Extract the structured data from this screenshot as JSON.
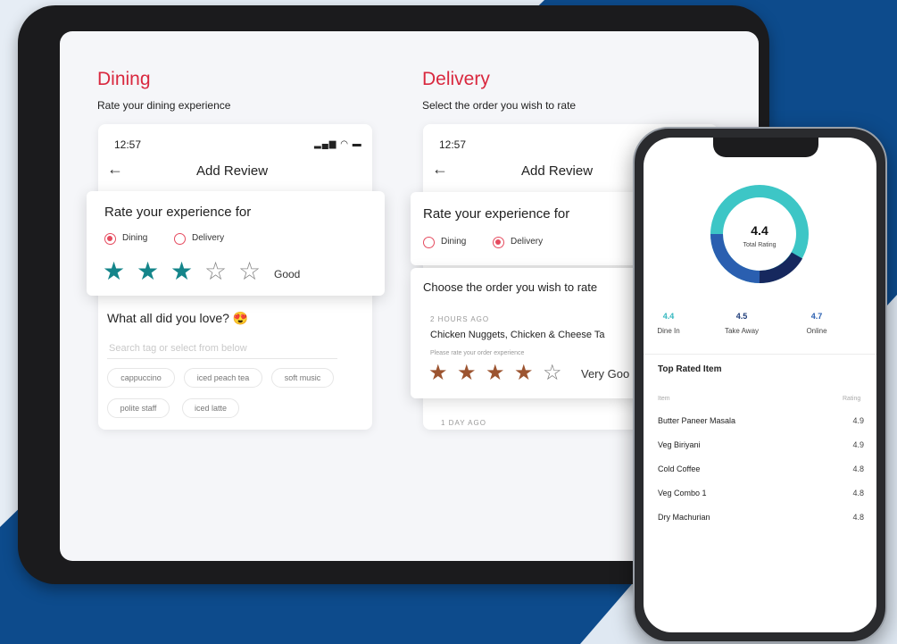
{
  "dining": {
    "title": "Dining",
    "subtitle": "Rate your dining experience",
    "time": "12:57",
    "header": "Add Review",
    "rate_title": "Rate your experience for",
    "radio_dining": "Dining",
    "radio_delivery": "Delivery",
    "selected": "Dining",
    "stars_filled": 3,
    "stars_total": 5,
    "rating_label": "Good",
    "love_question": "What all did you love? 😍",
    "search_placeholder": "Search tag or select from below",
    "tags": [
      "cappuccino",
      "iced peach tea",
      "soft music",
      "polite staff",
      "iced latte"
    ]
  },
  "delivery": {
    "title": "Delivery",
    "subtitle": "Select the order you wish to rate",
    "time": "12:57",
    "header": "Add Review",
    "rate_title": "Rate your experience for",
    "radio_dining": "Dining",
    "radio_delivery": "Delivery",
    "selected": "Delivery",
    "choose_title": "Choose the order you wish to rate",
    "order1": {
      "ago": "2 HOURS AGO",
      "name": "Chicken Nuggets, Chicken & Cheese Ta",
      "prompt": "Please rate your order experience",
      "stars_filled": 4,
      "rating_label": "Very Goo"
    },
    "order2_ago": "1 DAY AGO"
  },
  "phone": {
    "total_rating": "4.4",
    "total_label": "Total Rating",
    "stats": [
      {
        "value": "4.4",
        "label": "Dine In",
        "color": "#35b8c0"
      },
      {
        "value": "4.5",
        "label": "Take Away",
        "color": "#1f3d7a"
      },
      {
        "value": "4.7",
        "label": "Online",
        "color": "#2a5fb0"
      }
    ],
    "top_title": "Top Rated Item",
    "col_item": "Item",
    "col_rating": "Rating",
    "items": [
      {
        "name": "Butter Paneer Masala",
        "rating": "4.9"
      },
      {
        "name": "Veg Biriyani",
        "rating": "4.9"
      },
      {
        "name": "Cold Coffee",
        "rating": "4.8"
      },
      {
        "name": "Veg Combo 1",
        "rating": "4.8"
      },
      {
        "name": "Dry Machurian",
        "rating": "4.8"
      }
    ]
  },
  "colors": {
    "accent_red": "#d9283f",
    "teal_star": "#14858a",
    "brown_star": "#9c5430",
    "bg_blue": "#0d4b8c"
  },
  "icons": [
    "back-arrow-icon",
    "signal-wifi-battery-icon",
    "radio-icon",
    "star-icon"
  ]
}
